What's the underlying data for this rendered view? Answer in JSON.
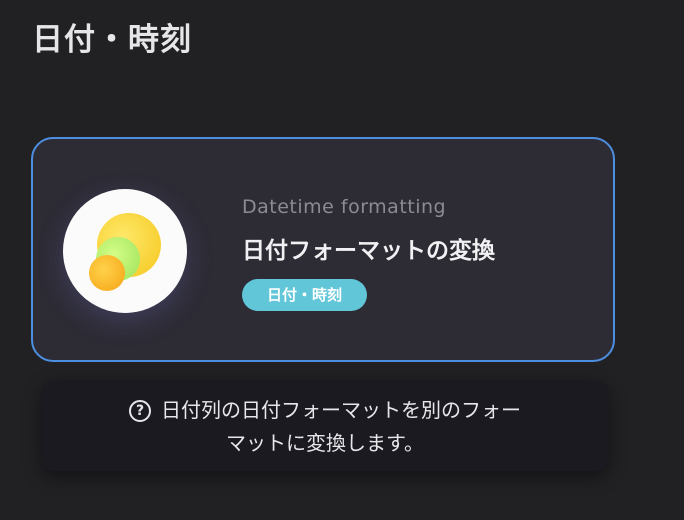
{
  "page": {
    "title": "日付・時刻"
  },
  "card": {
    "subtitle": "Datetime formatting",
    "title": "日付フォーマットの変換",
    "tag": "日付・時刻",
    "icon": "overlapping-circles-icon",
    "colors": {
      "border": "#4d8ee0",
      "tag": "#62c6d9"
    }
  },
  "tooltip": {
    "icon": "question-circle-icon",
    "icon_glyph": "?",
    "line1": "日付列の日付フォーマットを別のフォー",
    "line2": "マットに変換します。"
  }
}
